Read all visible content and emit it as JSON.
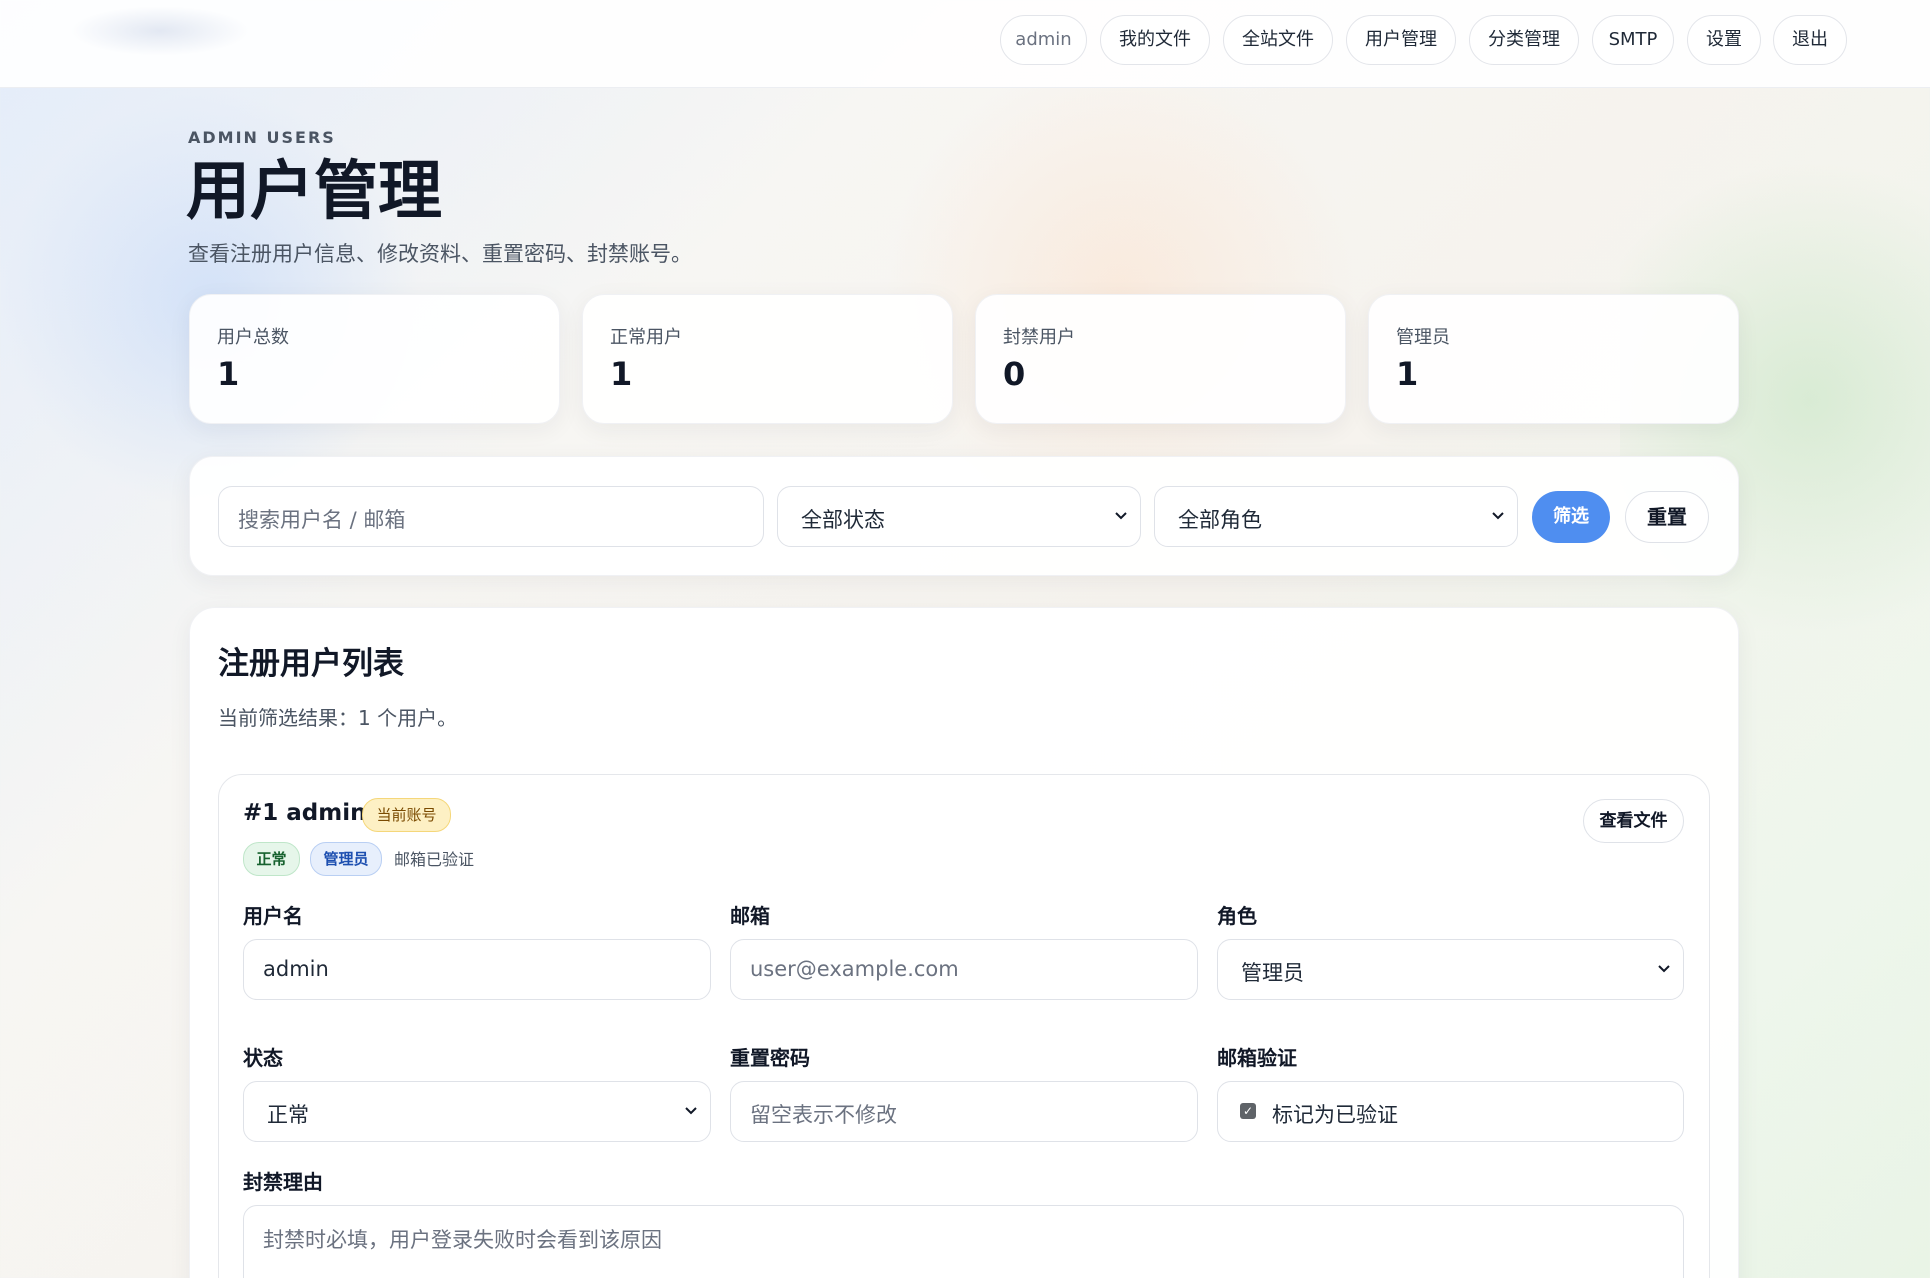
{
  "nav": {
    "items": [
      {
        "label": "admin"
      },
      {
        "label": "我的文件"
      },
      {
        "label": "全站文件"
      },
      {
        "label": "用户管理"
      },
      {
        "label": "分类管理"
      },
      {
        "label": "SMTP"
      },
      {
        "label": "设置"
      },
      {
        "label": "退出"
      }
    ]
  },
  "header": {
    "eyebrow": "ADMIN USERS",
    "title": "用户管理",
    "subtitle": "查看注册用户信息、修改资料、重置密码、封禁账号。"
  },
  "stats": [
    {
      "label": "用户总数",
      "value": "1"
    },
    {
      "label": "正常用户",
      "value": "1"
    },
    {
      "label": "封禁用户",
      "value": "0"
    },
    {
      "label": "管理员",
      "value": "1"
    }
  ],
  "filters": {
    "search_placeholder": "搜索用户名 / 邮箱",
    "status_value": "全部状态",
    "role_value": "全部角色",
    "filter_button": "筛选",
    "reset_button": "重置"
  },
  "list": {
    "title": "注册用户列表",
    "summary": "当前筛选结果：1 个用户。"
  },
  "user": {
    "heading": "#1 admin",
    "current_badge": "当前账号",
    "status_badge": "正常",
    "role_badge": "管理员",
    "verified_text": "邮箱已验证",
    "view_files_button": "查看文件",
    "fields": {
      "username_label": "用户名",
      "username_value": "admin",
      "email_label": "邮箱",
      "email_placeholder": "user@example.com",
      "role_label": "角色",
      "role_value": "管理员",
      "status_label": "状态",
      "status_value": "正常",
      "password_label": "重置密码",
      "password_placeholder": "留空表示不修改",
      "verify_label": "邮箱验证",
      "verify_checkbox_label": "标记为已验证",
      "verify_checked": true,
      "ban_reason_label": "封禁理由",
      "ban_reason_placeholder": "封禁时必填，用户登录失败时会看到该原因"
    }
  }
}
